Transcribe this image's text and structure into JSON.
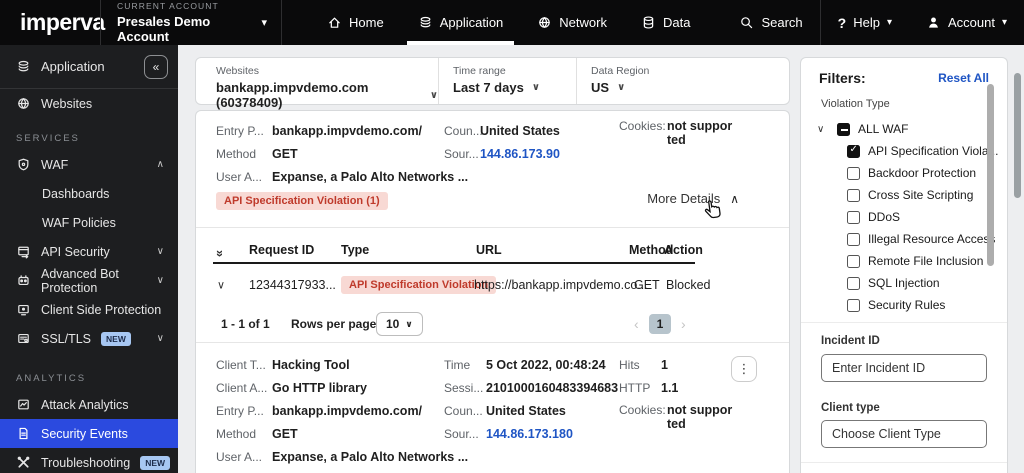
{
  "colors": {
    "accent_blue": "#2b4adf",
    "link_blue": "#1f55c4",
    "tag_bg": "#f8d9d4",
    "tag_text": "#bf3a2b",
    "new_badge_bg": "#a7c7f2",
    "topbar_bg": "#0a0a0b",
    "sidebar_bg": "#1d1e20"
  },
  "icons": {
    "collapse": "«",
    "caret_down": "∨",
    "caret_up": "∧",
    "dropdown": "▾",
    "prev": "‹",
    "next": "›",
    "kebab": "⋮",
    "double_chevron": "«"
  },
  "topbar": {
    "logo": "imperva",
    "account_label": "CURRENT ACCOUNT",
    "account_name": "Presales Demo Account",
    "nav_home": "Home",
    "nav_application": "Application",
    "nav_network": "Network",
    "nav_data": "Data",
    "search_label": "Search",
    "help_label": "Help",
    "account_menu_label": "Account"
  },
  "sidebar": {
    "header": "Application",
    "websites": "Websites",
    "services_section": "SERVICES",
    "waf": "WAF",
    "dashboards": "Dashboards",
    "waf_policies": "WAF Policies",
    "api_security": "API Security",
    "advanced_bot_protection": "Advanced Bot Protection",
    "client_side_protection": "Client Side Protection",
    "ssl_tls": "SSL/TLS",
    "analytics_section": "ANALYTICS",
    "attack_analytics": "Attack Analytics",
    "security_events": "Security Events",
    "troubleshooting": "Troubleshooting",
    "new_badge": "NEW"
  },
  "filterbar": {
    "websites": {
      "label": "Websites",
      "value": "bankapp.impvdemo.com (60378409)"
    },
    "time_range": {
      "label": "Time range",
      "value": "Last 7 days"
    },
    "data_region": {
      "label": "Data Region",
      "value": "US"
    }
  },
  "event1": {
    "fields_left": [
      {
        "label": "Entry P...",
        "value": "bankapp.impvdemo.com/"
      },
      {
        "label": "Method",
        "value": "GET"
      },
      {
        "label": "User A...",
        "value": "Expanse, a Palo Alto Networks ..."
      }
    ],
    "fields_mid": [
      {
        "label": "Coun...",
        "value": "United States"
      },
      {
        "label": "Sour...",
        "value": "144.86.173.90"
      }
    ],
    "cookies_label": "Cookies:",
    "cookies_value": "not supported",
    "tag": "API Specification Violation (1)",
    "more_details": "More Details"
  },
  "table": {
    "columns": [
      "Request ID",
      "Type",
      "URL",
      "Method",
      "Action"
    ],
    "row": {
      "request_id": "12344317933...",
      "type": "API Specification Violation",
      "url": "https://bankapp.impvdemo.co...",
      "method": "GET",
      "action": "Blocked"
    },
    "pagination": {
      "range": "1 - 1 of 1",
      "rows_per_page_label": "Rows per page",
      "rows_per_page_value": "10",
      "page": "1"
    }
  },
  "event2": {
    "fields_left": [
      {
        "label": "Client T...",
        "value": "Hacking Tool"
      },
      {
        "label": "Client A...",
        "value": "Go HTTP library"
      },
      {
        "label": "Entry P...",
        "value": "bankapp.impvdemo.com/"
      },
      {
        "label": "Method",
        "value": "GET"
      },
      {
        "label": "User A...",
        "value": "Expanse, a Palo Alto Networks ..."
      }
    ],
    "fields_mid": [
      {
        "label": "Time",
        "value": "5 Oct 2022, 00:48:24"
      },
      {
        "label": "Sessi...",
        "value": "2101000160483394683"
      },
      {
        "label": "Coun...",
        "value": "United States"
      },
      {
        "label": "Sour...",
        "value": "144.86.173.180"
      }
    ],
    "fields_right": [
      {
        "label": "Hits",
        "value": "1"
      },
      {
        "label": "HTTP",
        "value": "1.1"
      }
    ],
    "cookies_label": "Cookies:",
    "cookies_value": "not supported"
  },
  "filters_panel": {
    "title": "Filters:",
    "reset_all": "Reset All",
    "group_label": "Violation Type",
    "parent_option": {
      "label": "ALL WAF",
      "state": "indeterminate"
    },
    "options": [
      {
        "label": "API Specification Viola...",
        "state": "checked"
      },
      {
        "label": "Backdoor Protection",
        "state": "unchecked"
      },
      {
        "label": "Cross Site Scripting",
        "state": "unchecked"
      },
      {
        "label": "DDoS",
        "state": "unchecked"
      },
      {
        "label": "Illegal Resource Access",
        "state": "unchecked"
      },
      {
        "label": "Remote File Inclusion",
        "state": "unchecked"
      },
      {
        "label": "SQL Injection",
        "state": "unchecked"
      },
      {
        "label": "Security Rules",
        "state": "unchecked"
      }
    ],
    "incident_id": {
      "label": "Incident ID",
      "placeholder": "Enter Incident ID"
    },
    "client_type": {
      "label": "Client type",
      "placeholder": "Choose Client Type"
    }
  }
}
